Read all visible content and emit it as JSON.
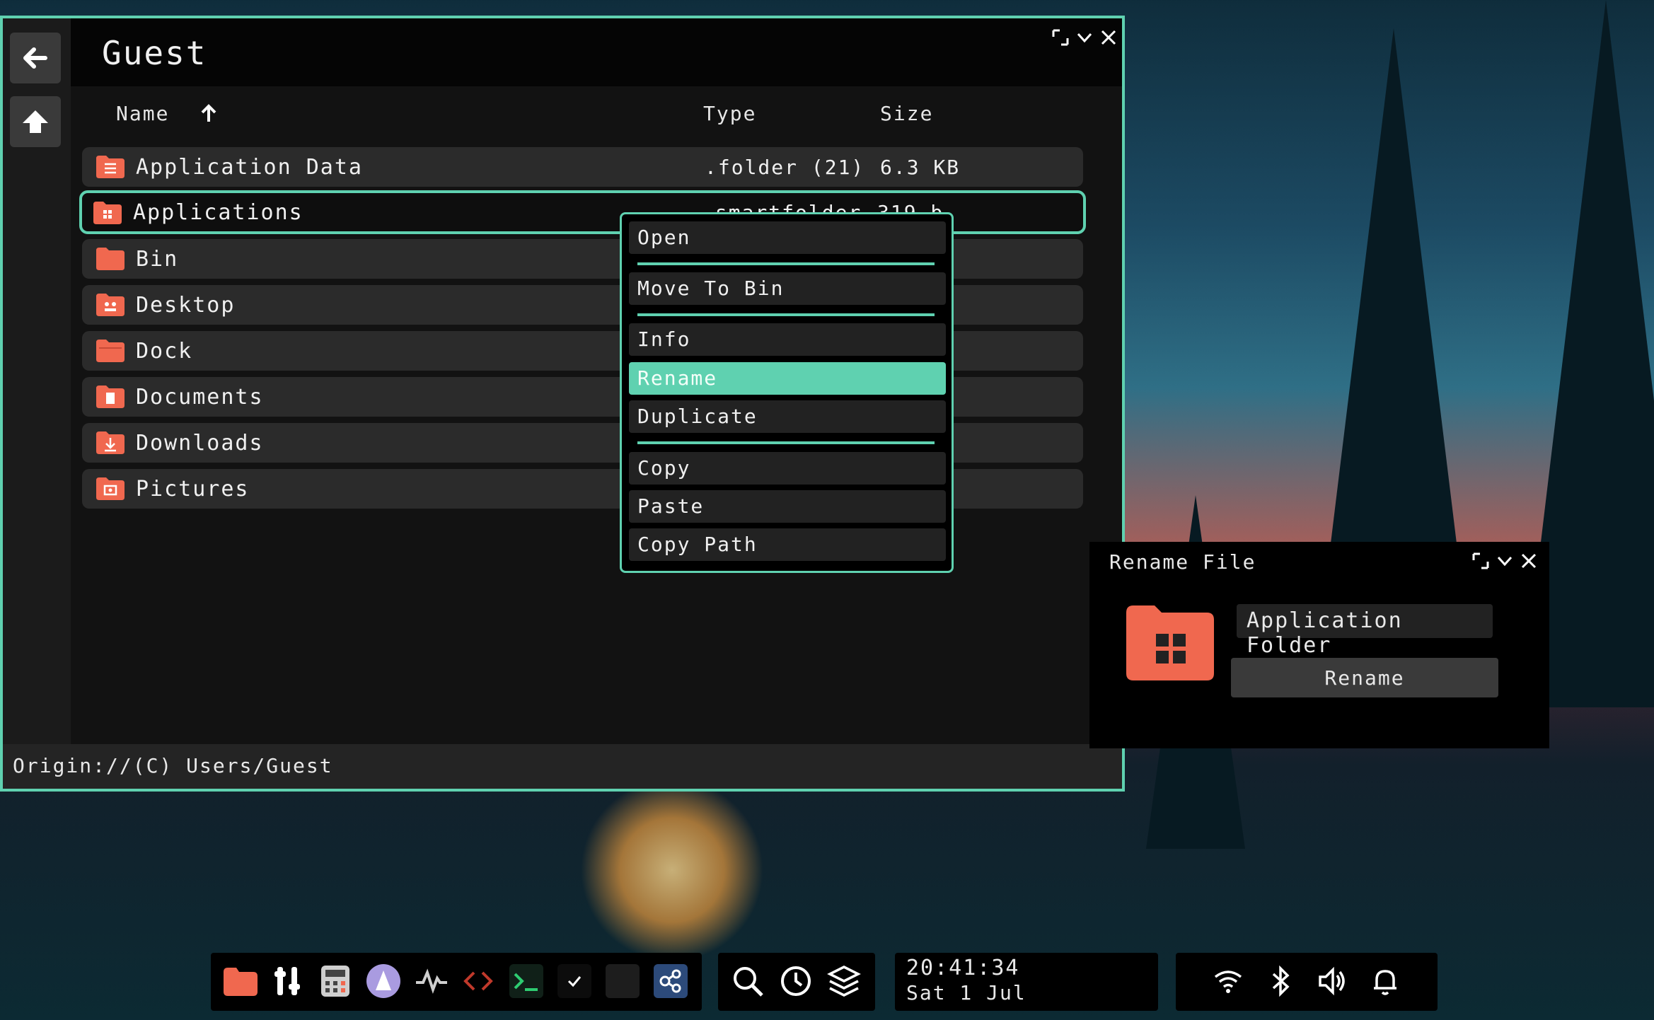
{
  "window": {
    "title": "Guest",
    "columns": {
      "name": "Name",
      "type": "Type",
      "size": "Size"
    },
    "rows": [
      {
        "name": "Application Data",
        "type": ".folder (21)",
        "size": "6.3 KB",
        "icon": "list-folder-icon"
      },
      {
        "name": "Applications",
        "type": ".smartfolder",
        "size": "319 b",
        "icon": "apps-folder-icon"
      },
      {
        "name": "Bin",
        "type": "",
        "size": "",
        "icon": "folder-icon"
      },
      {
        "name": "Desktop",
        "type": "",
        "size": "",
        "icon": "desktop-folder-icon"
      },
      {
        "name": "Dock",
        "type": "",
        "size": "",
        "icon": "folder-icon"
      },
      {
        "name": "Documents",
        "type": "",
        "size": "",
        "icon": "document-folder-icon"
      },
      {
        "name": "Downloads",
        "type": "",
        "size": "",
        "icon": "download-folder-icon"
      },
      {
        "name": "Pictures",
        "type": "",
        "size": "",
        "icon": "picture-folder-icon"
      }
    ],
    "status_path": "Origin://(C) Users/Guest"
  },
  "context_menu": {
    "items": [
      "Open",
      "Move To Bin",
      "Info",
      "Rename",
      "Duplicate",
      "Copy",
      "Paste",
      "Copy Path"
    ],
    "active": "Rename"
  },
  "rename_window": {
    "title": "Rename File",
    "field_value": "Application Folder",
    "button_label": "Rename"
  },
  "taskbar": {
    "time": "20:41:34",
    "date": "Sat 1 Jul"
  },
  "colors": {
    "accent": "#5fd1b0",
    "folder": "#f0684f"
  }
}
